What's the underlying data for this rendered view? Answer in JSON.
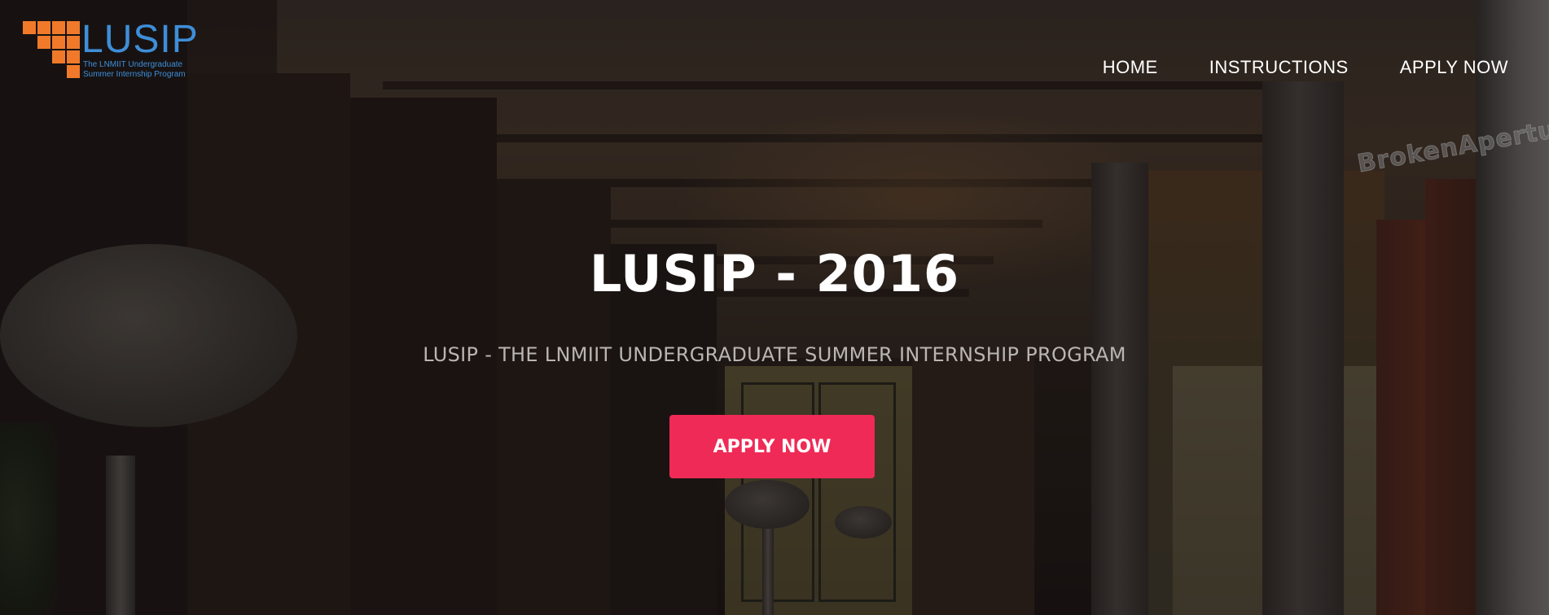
{
  "logo": {
    "title": "LUSIP",
    "subtitle_line1": "The LNMIIT Undergraduate",
    "subtitle_line2": "Summer Internship Program",
    "brand_color": "#3e8ed8",
    "mark_color": "#f07a2a"
  },
  "nav": {
    "items": [
      {
        "label": "HOME"
      },
      {
        "label": "INSTRUCTIONS"
      },
      {
        "label": "APPLY NOW"
      }
    ]
  },
  "hero": {
    "title": "LUSIP - 2016",
    "subtitle": "LUSIP - THE LNMIIT UNDERGRADUATE SUMMER INTERNSHIP PROGRAM",
    "cta_label": "APPLY NOW",
    "cta_color": "#ef2a56"
  },
  "background": {
    "watermark": "BrokenAperture"
  }
}
